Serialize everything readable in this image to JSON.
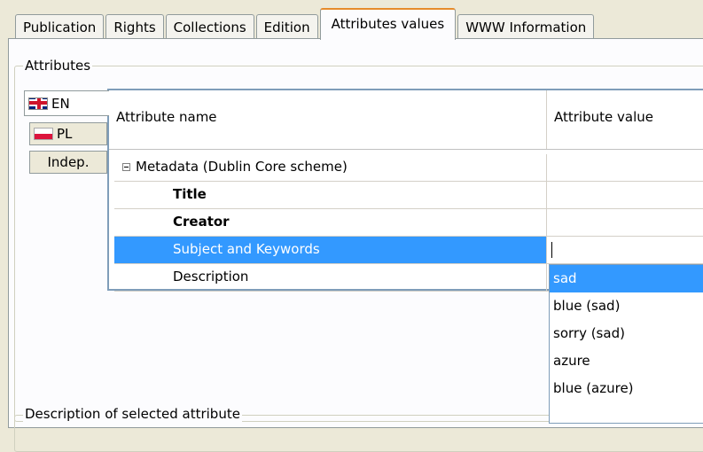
{
  "tabs": [
    "Publication",
    "Rights",
    "Collections",
    "Edition",
    "Attributes values",
    "WWW Information"
  ],
  "active_tab": "Attributes values",
  "attributes_group": {
    "title": "Attributes"
  },
  "languages": [
    {
      "code": "EN",
      "flag": "flag-en"
    },
    {
      "code": "PL",
      "flag": "flag-pl"
    },
    {
      "code": "Indep.",
      "flag": ""
    }
  ],
  "table": {
    "headers": {
      "name": "Attribute name",
      "value": "Attribute value"
    },
    "rows": [
      {
        "name": "Metadata (Dublin Core scheme)",
        "value": "",
        "kind": "group"
      },
      {
        "name": "Title",
        "value": "",
        "kind": "bold"
      },
      {
        "name": "Creator",
        "value": "",
        "kind": "bold"
      },
      {
        "name": "Subject and Keywords",
        "value": "",
        "kind": "selected"
      },
      {
        "name": "Description",
        "value": "",
        "kind": "normal"
      }
    ]
  },
  "dropdown": {
    "items": [
      "sad",
      "blue (sad)",
      "sorry (sad)",
      "azure",
      "blue (azure)"
    ],
    "selected_index": 0
  },
  "description_group": {
    "title": "Description of selected attribute"
  },
  "colors": {
    "selection": "#3399ff",
    "active_tab_accent": "#e68b2c"
  }
}
